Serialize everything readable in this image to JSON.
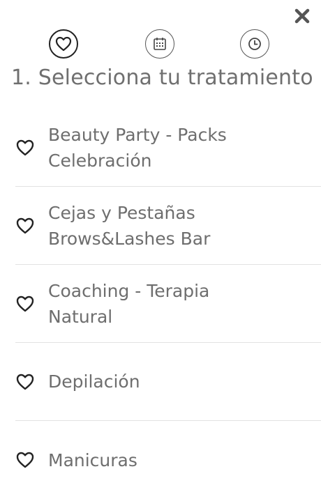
{
  "header": {
    "close_icon": "close-icon",
    "steps": [
      {
        "icon": "heart-icon",
        "state": "active"
      },
      {
        "icon": "calendar-icon",
        "state": "inactive"
      },
      {
        "icon": "clock-icon",
        "state": "inactive"
      }
    ],
    "title": "1. Selecciona tu tratamiento"
  },
  "treatments": [
    {
      "line1": "Beauty Party - Packs",
      "line2": "Celebración",
      "icon": "heart-outline-icon"
    },
    {
      "line1": "Cejas y Pestañas",
      "line2": "Brows&Lashes Bar",
      "icon": "heart-outline-icon"
    },
    {
      "line1": "Coaching - Terapia",
      "line2": "Natural",
      "icon": "heart-outline-icon"
    },
    {
      "line1": "Depilación",
      "icon": "heart-outline-icon"
    },
    {
      "line1": "Manicuras",
      "icon": "heart-outline-icon"
    }
  ],
  "colors": {
    "text": "#6e6e6e",
    "divider": "#e2e2e2",
    "icon": "#222222"
  }
}
